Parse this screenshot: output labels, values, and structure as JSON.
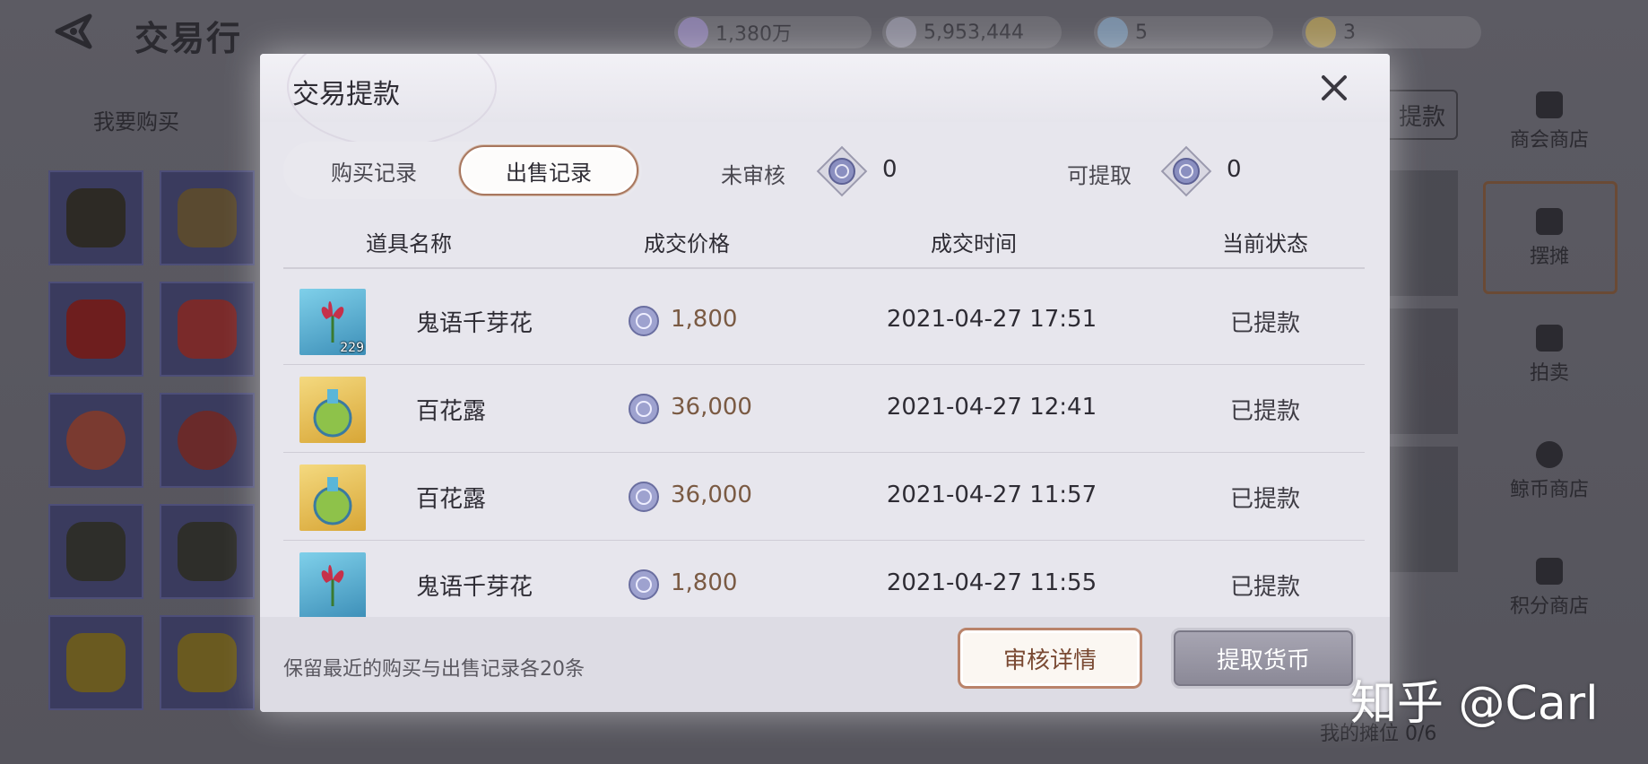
{
  "header": {
    "title": "交易行",
    "currencies": [
      {
        "icon": "diamond-gem-icon",
        "value": "1,380万"
      },
      {
        "icon": "silver-coin-icon",
        "value": "5,953,444"
      },
      {
        "icon": "rainbow-gem-icon",
        "value": "5"
      },
      {
        "icon": "gold-ticket-icon",
        "value": "3"
      }
    ]
  },
  "market": {
    "buy_tab": "我要购买",
    "withdraw_button": "提款"
  },
  "side_menu": {
    "items": [
      {
        "label": "商会商店",
        "icon": "merchant-guild-icon"
      },
      {
        "label": "摆摊",
        "icon": "stall-icon"
      },
      {
        "label": "拍卖",
        "icon": "auction-hammer-icon"
      },
      {
        "label": "鲸币商店",
        "icon": "whale-coin-icon"
      },
      {
        "label": "积分商店",
        "icon": "points-shop-icon"
      }
    ],
    "stall_count": "我的摊位 0/6"
  },
  "modal": {
    "title": "交易提款",
    "tabs": [
      "购买记录",
      "出售记录"
    ],
    "active_tab": "出售记录",
    "pending_label": "未审核",
    "pending_value": "0",
    "available_label": "可提取",
    "available_value": "0",
    "columns": [
      "道具名称",
      "成交价格",
      "成交时间",
      "当前状态"
    ],
    "rows": [
      {
        "icon": "flower-icon",
        "count": "229",
        "name": "鬼语千芽花",
        "price": "1,800",
        "time": "2021-04-27 17:51",
        "status": "已提款"
      },
      {
        "icon": "potion-icon",
        "count": "",
        "name": "百花露",
        "price": "36,000",
        "time": "2021-04-27 12:41",
        "status": "已提款"
      },
      {
        "icon": "potion-icon",
        "count": "",
        "name": "百花露",
        "price": "36,000",
        "time": "2021-04-27 11:57",
        "status": "已提款"
      },
      {
        "icon": "flower-icon",
        "count": "",
        "name": "鬼语千芽花",
        "price": "1,800",
        "time": "2021-04-27 11:55",
        "status": "已提款"
      }
    ],
    "footer_note": "保留最近的购买与出售记录各20条",
    "review_button": "审核详情",
    "withdraw_button": "提取货币"
  },
  "watermark": "知乎 @Carl",
  "colors": {
    "accent": "#a8775f",
    "price": "#7a5a43",
    "modal_bg": "#e7e6ed"
  }
}
